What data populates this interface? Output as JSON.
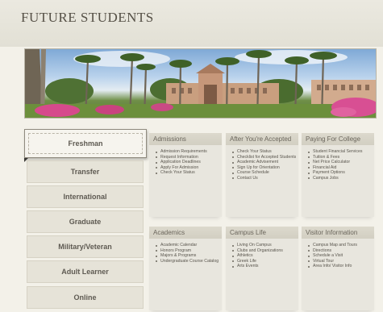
{
  "header": {
    "title": "FUTURE STUDENTS"
  },
  "sidebar": {
    "items": [
      {
        "label": "Freshman",
        "active": true
      },
      {
        "label": "Transfer"
      },
      {
        "label": "International"
      },
      {
        "label": "Graduate"
      },
      {
        "label": "Military/Veteran"
      },
      {
        "label": "Adult Learner"
      },
      {
        "label": "Online"
      }
    ]
  },
  "panels": [
    {
      "title": "Admissions",
      "links": [
        "Admission Requirements",
        "Request Information",
        "Application Deadlines",
        "Apply For Admission",
        "Check Your Status"
      ]
    },
    {
      "title": "After You're Accepted",
      "links": [
        "Check Your Status",
        "Checklist for Accepted Students",
        "Academic Advisement",
        "Sign Up for Orientation",
        "Course Schedule",
        "Contact Us"
      ]
    },
    {
      "title": "Paying For College",
      "links": [
        "Student Financial Services",
        "Tuition & Fees",
        "Net Price Calculator",
        "Financial Aid",
        "Payment Options",
        "Campus Jobs"
      ]
    },
    {
      "title": "Academics",
      "links": [
        "Academic Calendar",
        "Honors Program",
        "Majors & Programs",
        "Undergraduate Course Catalog"
      ]
    },
    {
      "title": "Campus Life",
      "links": [
        "Living On Campus",
        "Clubs and Organizations",
        "Athletics",
        "Greek Life",
        "Arts Events"
      ]
    },
    {
      "title": "Visitor Information",
      "links": [
        "Campus Map and Tours",
        "Directions",
        "Schedule a Visit",
        "Virtual Tour",
        "Area Info/ Visitor Info"
      ]
    }
  ]
}
